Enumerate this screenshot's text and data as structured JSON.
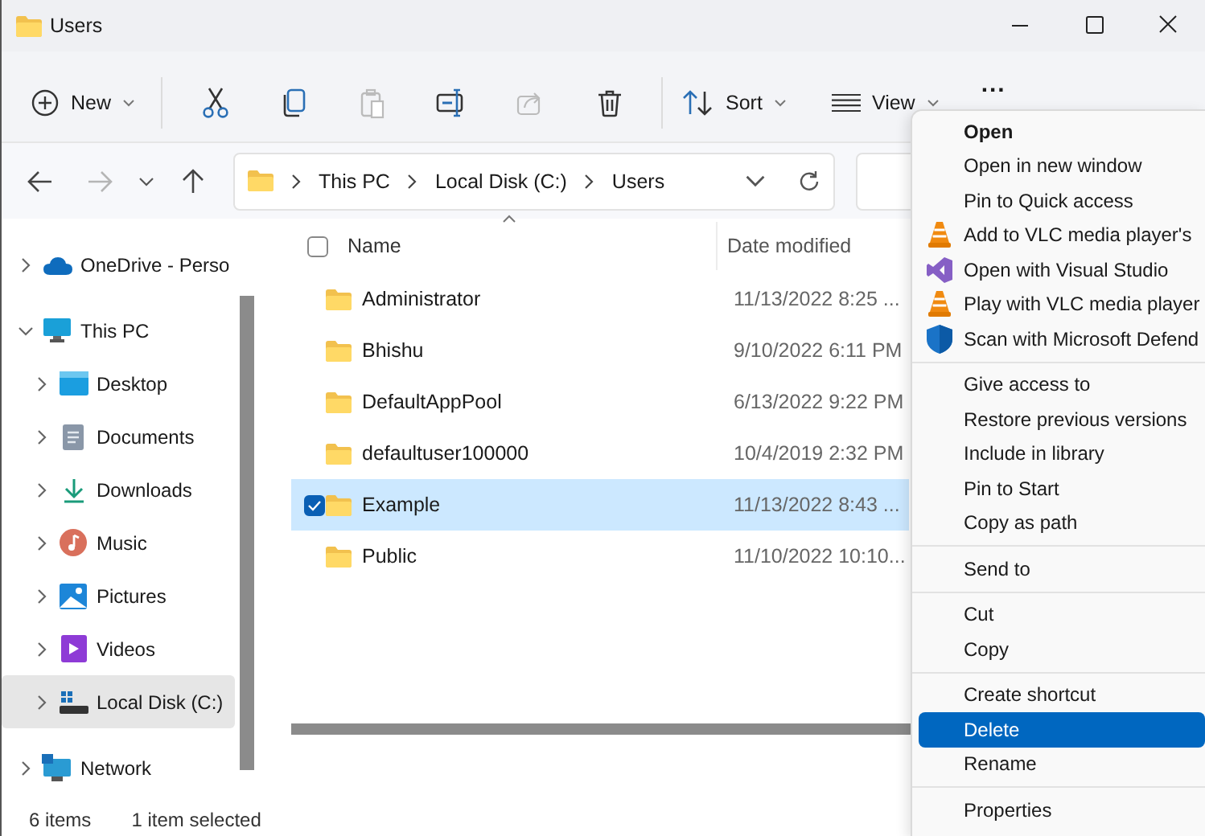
{
  "window": {
    "title": "Users"
  },
  "toolbar": [
    {
      "kind": "new",
      "label": "New",
      "caret": true,
      "disabled": false
    },
    {
      "kind": "separator"
    },
    {
      "kind": "cut",
      "disabled": false
    },
    {
      "kind": "copy",
      "disabled": false
    },
    {
      "kind": "paste",
      "disabled": true
    },
    {
      "kind": "rename",
      "disabled": false
    },
    {
      "kind": "share",
      "disabled": true
    },
    {
      "kind": "delete",
      "disabled": false
    },
    {
      "kind": "separator"
    },
    {
      "kind": "sort",
      "label": "Sort",
      "caret": true,
      "disabled": false
    },
    {
      "kind": "view",
      "label": "View",
      "caret": true,
      "disabled": false
    },
    {
      "kind": "more",
      "label": "...",
      "disabled": false
    }
  ],
  "navigation": {
    "back_disabled": false,
    "forward_disabled": true
  },
  "address": {
    "path": [
      "This PC",
      "Local Disk (C:)",
      "Users"
    ]
  },
  "sidebar": {
    "items": [
      {
        "label": "OneDrive - Perso",
        "kind": "cloud",
        "expanded": false,
        "selected": false
      },
      {
        "label": "This PC",
        "kind": "pc",
        "expanded": true,
        "selected": false,
        "children": [
          {
            "label": "Desktop",
            "kind": "desktop",
            "expanded": false,
            "selected": false
          },
          {
            "label": "Documents",
            "kind": "documents",
            "expanded": false,
            "selected": false
          },
          {
            "label": "Downloads",
            "kind": "downloads",
            "expanded": false,
            "selected": false
          },
          {
            "label": "Music",
            "kind": "music",
            "expanded": false,
            "selected": false
          },
          {
            "label": "Pictures",
            "kind": "pictures",
            "expanded": false,
            "selected": false
          },
          {
            "label": "Videos",
            "kind": "videos",
            "expanded": false,
            "selected": false
          },
          {
            "label": "Local Disk (C:)",
            "kind": "disk",
            "expanded": false,
            "selected": true
          }
        ]
      },
      {
        "label": "Network",
        "kind": "network",
        "expanded": false,
        "selected": false
      }
    ]
  },
  "table": {
    "select_all_checked": false,
    "columns": [
      "Name",
      "Date modified"
    ],
    "rows": [
      {
        "name": "Administrator",
        "date": "11/13/2022 8:25 ...",
        "selected": false,
        "checked": false
      },
      {
        "name": "Bhishu",
        "date": "9/10/2022 6:11 PM",
        "selected": false,
        "checked": false
      },
      {
        "name": "DefaultAppPool",
        "date": "6/13/2022 9:22 PM",
        "selected": false,
        "checked": false
      },
      {
        "name": "defaultuser100000",
        "date": "10/4/2019 2:32 PM",
        "selected": false,
        "checked": false
      },
      {
        "name": "Example",
        "date": "11/13/2022 8:43 ...",
        "selected": true,
        "checked": true
      },
      {
        "name": "Public",
        "date": "11/10/2022 10:10...",
        "selected": false,
        "checked": false
      }
    ]
  },
  "status_bar": {
    "count": "6 items",
    "selection": "1 item selected"
  },
  "context_menu": {
    "groups": [
      [
        {
          "label": "Open",
          "default": true,
          "selected": false
        },
        {
          "label": "Open in new window",
          "default": false,
          "selected": false
        },
        {
          "label": "Pin to Quick access",
          "default": false,
          "selected": false
        },
        {
          "label": "Add to VLC media player's",
          "kind": "vlc",
          "default": false,
          "selected": false
        },
        {
          "label": "Open with Visual Studio",
          "kind": "visual-studio",
          "default": false,
          "selected": false
        },
        {
          "label": "Play with VLC media player",
          "kind": "vlc",
          "default": false,
          "selected": false
        },
        {
          "label": "Scan with Microsoft Defend",
          "kind": "defender",
          "default": false,
          "selected": false
        }
      ],
      [
        {
          "label": "Give access to",
          "default": false,
          "selected": false
        },
        {
          "label": "Restore previous versions",
          "default": false,
          "selected": false
        },
        {
          "label": "Include in library",
          "default": false,
          "selected": false
        },
        {
          "label": "Pin to Start",
          "default": false,
          "selected": false
        },
        {
          "label": "Copy as path",
          "default": false,
          "selected": false
        }
      ],
      [
        {
          "label": "Send to",
          "default": false,
          "selected": false
        }
      ],
      [
        {
          "label": "Cut",
          "default": false,
          "selected": false
        },
        {
          "label": "Copy",
          "default": false,
          "selected": false
        }
      ],
      [
        {
          "label": "Create shortcut",
          "default": false,
          "selected": false
        },
        {
          "label": "Delete",
          "default": false,
          "selected": true
        },
        {
          "label": "Rename",
          "default": false,
          "selected": false
        }
      ],
      [
        {
          "label": "Properties",
          "default": false,
          "selected": false
        }
      ]
    ]
  }
}
